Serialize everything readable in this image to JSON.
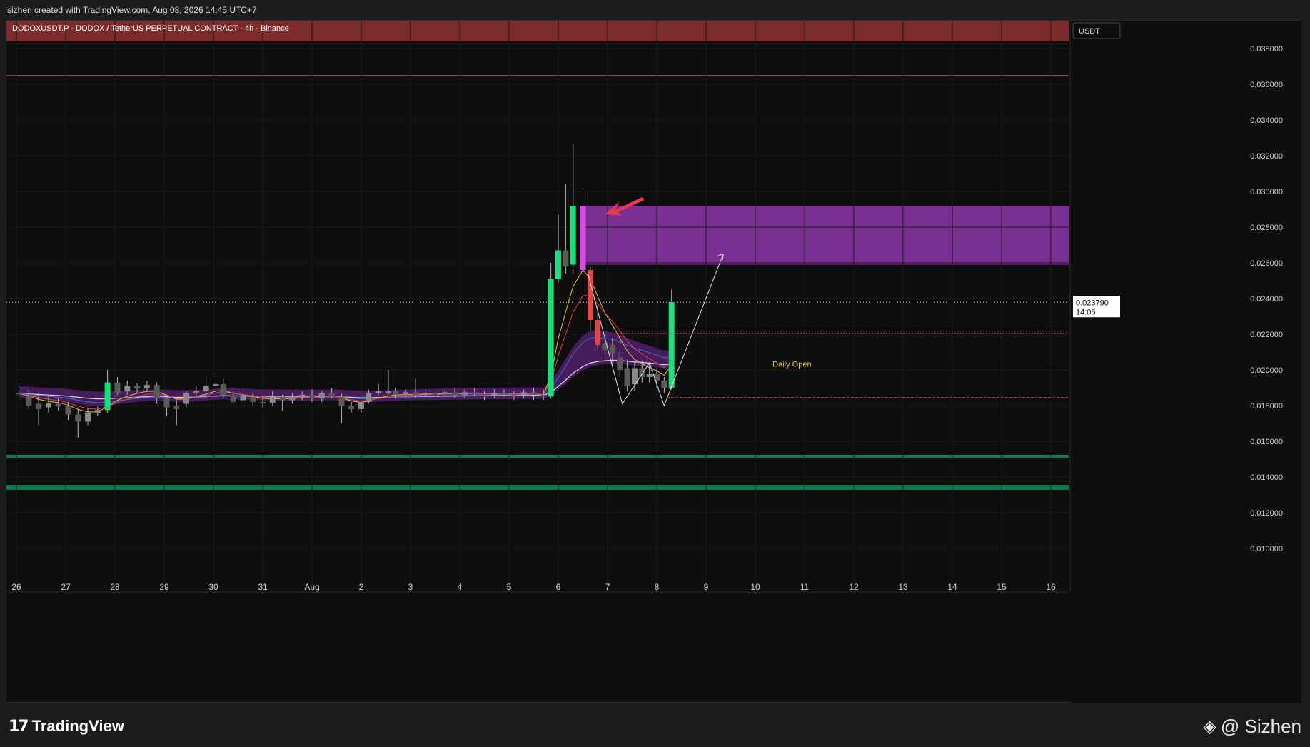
{
  "header": {
    "credit": "sizhen created with TradingView.com, Aug 08, 2026 14:45 UTC+7",
    "symbol_line": "DODOXUSDT.P · DODOX / TetherUS PERPETUAL CONTRACT · 4h · Binance",
    "currency": "USDT"
  },
  "footer": {
    "brand_mark": "17",
    "brand": "TradingView",
    "author": "@ Sizhen"
  },
  "chart_data": {
    "type": "candlestick",
    "ylim": [
      0.0086,
      0.04
    ],
    "y_ticks": [
      "0.038000",
      "0.036000",
      "0.034000",
      "0.032000",
      "0.030000",
      "0.028000",
      "0.026000",
      "0.024000",
      "0.022000",
      "0.020000",
      "0.018000",
      "0.016000",
      "0.014000",
      "0.012000",
      "0.010000"
    ],
    "x_ticks": [
      "26",
      "27",
      "28",
      "29",
      "30",
      "31",
      "Aug",
      "2",
      "3",
      "4",
      "5",
      "6",
      "7",
      "8",
      "9",
      "10",
      "11",
      "12",
      "13",
      "14",
      "15",
      "16"
    ],
    "last_price": "0.023790",
    "countdown": "14:06",
    "annotations": {
      "daily_open_label": "Daily Open",
      "daily_open_price": 0.01845,
      "resistance_zone": [
        0.0384,
        0.04
      ],
      "resistance_line": 0.0365,
      "supply_zone": [
        0.0259,
        0.0292
      ],
      "red_level": 0.02205,
      "support_lines": [
        0.01516,
        0.0134
      ]
    },
    "candles": [
      {
        "x": 26.05,
        "o": 0.0187,
        "c": 0.01865,
        "h": 0.01935,
        "l": 0.0184
      },
      {
        "x": 26.25,
        "o": 0.01855,
        "c": 0.018,
        "h": 0.0189,
        "l": 0.0178
      },
      {
        "x": 26.45,
        "o": 0.0181,
        "c": 0.0178,
        "h": 0.0187,
        "l": 0.0169
      },
      {
        "x": 26.65,
        "o": 0.0179,
        "c": 0.01815,
        "h": 0.0185,
        "l": 0.0176
      },
      {
        "x": 26.85,
        "o": 0.0181,
        "c": 0.01795,
        "h": 0.01845,
        "l": 0.0177
      },
      {
        "x": 27.05,
        "o": 0.018,
        "c": 0.0175,
        "h": 0.0182,
        "l": 0.0172
      },
      {
        "x": 27.25,
        "o": 0.0175,
        "c": 0.0171,
        "h": 0.0178,
        "l": 0.0162
      },
      {
        "x": 27.45,
        "o": 0.0171,
        "c": 0.0176,
        "h": 0.0179,
        "l": 0.0169
      },
      {
        "x": 27.65,
        "o": 0.0176,
        "c": 0.01775,
        "h": 0.018,
        "l": 0.0174
      },
      {
        "x": 27.85,
        "o": 0.01775,
        "c": 0.0193,
        "h": 0.02,
        "l": 0.0176
      },
      {
        "x": 28.05,
        "o": 0.0193,
        "c": 0.0187,
        "h": 0.0196,
        "l": 0.0186
      },
      {
        "x": 28.25,
        "o": 0.0188,
        "c": 0.0191,
        "h": 0.0194,
        "l": 0.0186
      },
      {
        "x": 28.45,
        "o": 0.0191,
        "c": 0.01895,
        "h": 0.01925,
        "l": 0.0187
      },
      {
        "x": 28.65,
        "o": 0.01895,
        "c": 0.01915,
        "h": 0.0194,
        "l": 0.0188
      },
      {
        "x": 28.85,
        "o": 0.01915,
        "c": 0.0184,
        "h": 0.0193,
        "l": 0.0181
      },
      {
        "x": 29.05,
        "o": 0.0184,
        "c": 0.0179,
        "h": 0.0185,
        "l": 0.0174
      },
      {
        "x": 29.25,
        "o": 0.018,
        "c": 0.0178,
        "h": 0.0183,
        "l": 0.0169
      },
      {
        "x": 29.45,
        "o": 0.0181,
        "c": 0.0187,
        "h": 0.0188,
        "l": 0.0179
      },
      {
        "x": 29.65,
        "o": 0.0187,
        "c": 0.0188,
        "h": 0.0191,
        "l": 0.0185
      },
      {
        "x": 29.85,
        "o": 0.0188,
        "c": 0.0191,
        "h": 0.0196,
        "l": 0.0187
      },
      {
        "x": 30.05,
        "o": 0.0191,
        "c": 0.0192,
        "h": 0.0199,
        "l": 0.019
      },
      {
        "x": 30.2,
        "o": 0.0192,
        "c": 0.0186,
        "h": 0.0195,
        "l": 0.0184
      },
      {
        "x": 30.4,
        "o": 0.0186,
        "c": 0.0182,
        "h": 0.0188,
        "l": 0.018
      },
      {
        "x": 30.6,
        "o": 0.0183,
        "c": 0.0185,
        "h": 0.0187,
        "l": 0.0181
      },
      {
        "x": 30.8,
        "o": 0.0185,
        "c": 0.0182,
        "h": 0.0187,
        "l": 0.018
      },
      {
        "x": 31.0,
        "o": 0.0182,
        "c": 0.01815,
        "h": 0.0185,
        "l": 0.0179
      },
      {
        "x": 31.2,
        "o": 0.01815,
        "c": 0.0185,
        "h": 0.0188,
        "l": 0.018
      },
      {
        "x": 31.4,
        "o": 0.0185,
        "c": 0.0183,
        "h": 0.0186,
        "l": 0.0177
      },
      {
        "x": 31.6,
        "o": 0.0183,
        "c": 0.0185,
        "h": 0.0187,
        "l": 0.0181
      },
      {
        "x": 31.8,
        "o": 0.0185,
        "c": 0.0186,
        "h": 0.0188,
        "l": 0.0183
      },
      {
        "x": 32.0,
        "o": 0.0186,
        "c": 0.0184,
        "h": 0.0189,
        "l": 0.0182
      },
      {
        "x": 32.2,
        "o": 0.0184,
        "c": 0.0187,
        "h": 0.0188,
        "l": 0.0182
      },
      {
        "x": 32.4,
        "o": 0.0187,
        "c": 0.0185,
        "h": 0.019,
        "l": 0.0184
      },
      {
        "x": 32.6,
        "o": 0.0185,
        "c": 0.018,
        "h": 0.0187,
        "l": 0.017
      },
      {
        "x": 32.8,
        "o": 0.018,
        "c": 0.0178,
        "h": 0.0182,
        "l": 0.0176
      },
      {
        "x": 33.0,
        "o": 0.0178,
        "c": 0.0182,
        "h": 0.0183,
        "l": 0.0176
      },
      {
        "x": 33.15,
        "o": 0.0182,
        "c": 0.0187,
        "h": 0.0189,
        "l": 0.0181
      },
      {
        "x": 33.35,
        "o": 0.0187,
        "c": 0.0188,
        "h": 0.0192,
        "l": 0.0186
      },
      {
        "x": 33.55,
        "o": 0.0187,
        "c": 0.0188,
        "h": 0.02,
        "l": 0.0186
      },
      {
        "x": 33.7,
        "o": 0.0188,
        "c": 0.0186,
        "h": 0.019,
        "l": 0.0184
      },
      {
        "x": 33.9,
        "o": 0.0186,
        "c": 0.01875,
        "h": 0.0189,
        "l": 0.0185
      },
      {
        "x": 34.1,
        "o": 0.01875,
        "c": 0.0186,
        "h": 0.0195,
        "l": 0.0184
      },
      {
        "x": 34.3,
        "o": 0.0186,
        "c": 0.0187,
        "h": 0.0189,
        "l": 0.0185
      },
      {
        "x": 34.5,
        "o": 0.0187,
        "c": 0.01865,
        "h": 0.0189,
        "l": 0.0185
      },
      {
        "x": 34.7,
        "o": 0.01865,
        "c": 0.01875,
        "h": 0.0189,
        "l": 0.0185
      },
      {
        "x": 34.9,
        "o": 0.01875,
        "c": 0.0186,
        "h": 0.019,
        "l": 0.0184
      },
      {
        "x": 35.1,
        "o": 0.0186,
        "c": 0.01875,
        "h": 0.0189,
        "l": 0.0184
      },
      {
        "x": 35.3,
        "o": 0.01875,
        "c": 0.01865,
        "h": 0.019,
        "l": 0.0185
      },
      {
        "x": 35.5,
        "o": 0.01865,
        "c": 0.0186,
        "h": 0.0188,
        "l": 0.0183
      },
      {
        "x": 35.7,
        "o": 0.0186,
        "c": 0.0187,
        "h": 0.0189,
        "l": 0.0184
      },
      {
        "x": 35.9,
        "o": 0.0187,
        "c": 0.01865,
        "h": 0.0189,
        "l": 0.0185
      },
      {
        "x": 36.1,
        "o": 0.01865,
        "c": 0.0186,
        "h": 0.0188,
        "l": 0.0183
      },
      {
        "x": 36.3,
        "o": 0.0186,
        "c": 0.01875,
        "h": 0.0189,
        "l": 0.0184
      },
      {
        "x": 36.5,
        "o": 0.01875,
        "c": 0.0186,
        "h": 0.019,
        "l": 0.0183
      },
      {
        "x": 36.7,
        "o": 0.0186,
        "c": 0.0185,
        "h": 0.0189,
        "l": 0.0183
      },
      {
        "x": 36.85,
        "o": 0.0185,
        "c": 0.0251,
        "h": 0.026,
        "l": 0.0184
      },
      {
        "x": 37.0,
        "o": 0.0251,
        "c": 0.0267,
        "h": 0.0287,
        "l": 0.0249
      },
      {
        "x": 37.15,
        "o": 0.0267,
        "c": 0.0258,
        "h": 0.0304,
        "l": 0.0254
      },
      {
        "x": 37.3,
        "o": 0.0259,
        "c": 0.0292,
        "h": 0.0327,
        "l": 0.0254
      },
      {
        "x": 37.5,
        "o": 0.0292,
        "c": 0.0256,
        "h": 0.0302,
        "l": 0.0253
      },
      {
        "x": 37.65,
        "o": 0.0256,
        "c": 0.0228,
        "h": 0.0258,
        "l": 0.0222
      },
      {
        "x": 37.8,
        "o": 0.0228,
        "c": 0.0214,
        "h": 0.0236,
        "l": 0.0211
      },
      {
        "x": 37.95,
        "o": 0.0215,
        "c": 0.0211,
        "h": 0.023,
        "l": 0.0206
      },
      {
        "x": 38.1,
        "o": 0.0214,
        "c": 0.0209,
        "h": 0.0218,
        "l": 0.0202
      },
      {
        "x": 38.25,
        "o": 0.0207,
        "c": 0.02,
        "h": 0.021,
        "l": 0.0196
      },
      {
        "x": 38.4,
        "o": 0.0201,
        "c": 0.0191,
        "h": 0.0206,
        "l": 0.0188
      },
      {
        "x": 38.55,
        "o": 0.0192,
        "c": 0.0201,
        "h": 0.0205,
        "l": 0.0188
      },
      {
        "x": 38.7,
        "o": 0.0201,
        "c": 0.0196,
        "h": 0.0205,
        "l": 0.0193
      },
      {
        "x": 38.85,
        "o": 0.0196,
        "c": 0.0198,
        "h": 0.0204,
        "l": 0.0193
      },
      {
        "x": 39.0,
        "o": 0.0198,
        "c": 0.0194,
        "h": 0.0201,
        "l": 0.019
      },
      {
        "x": 39.15,
        "o": 0.0194,
        "c": 0.019,
        "h": 0.0196,
        "l": 0.0187
      },
      {
        "x": 39.3,
        "o": 0.019,
        "c": 0.0238,
        "h": 0.0245,
        "l": 0.0189
      }
    ]
  }
}
